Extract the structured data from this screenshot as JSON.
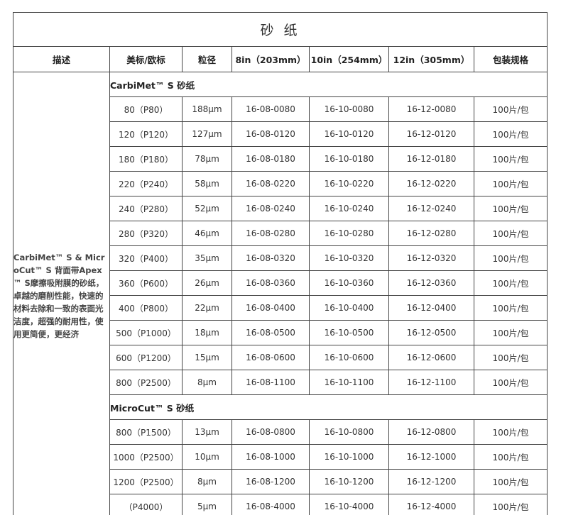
{
  "title": "砂 纸",
  "headers": [
    "描述",
    "美标/欧标",
    "粒径",
    "8in（203mm）",
    "10in（254mm）",
    "12in（305mm）",
    "包装规格"
  ],
  "description": "CarbiMet™ S & MicroCut™ S 背面带Apex™ S摩擦吸附膜的砂纸，卓越的磨削性能，快速的材料去除和一致的表面光洁度，超强的耐用性，使用更简便，更经济",
  "sections": [
    {
      "name": "CarbiMet™ S 砂纸",
      "rows": [
        [
          "80（P80）",
          "188μm",
          "16-08-0080",
          "16-10-0080",
          "16-12-0080",
          "100片/包"
        ],
        [
          "120（P120）",
          "127μm",
          "16-08-0120",
          "16-10-0120",
          "16-12-0120",
          "100片/包"
        ],
        [
          "180（P180）",
          "78μm",
          "16-08-0180",
          "16-10-0180",
          "16-12-0180",
          "100片/包"
        ],
        [
          "220（P240）",
          "58μm",
          "16-08-0220",
          "16-10-0220",
          "16-12-0220",
          "100片/包"
        ],
        [
          "240（P280）",
          "52μm",
          "16-08-0240",
          "16-10-0240",
          "16-12-0240",
          "100片/包"
        ],
        [
          "280（P320）",
          "46μm",
          "16-08-0280",
          "16-10-0280",
          "16-12-0280",
          "100片/包"
        ],
        [
          "320（P400）",
          "35μm",
          "16-08-0320",
          "16-10-0320",
          "16-12-0320",
          "100片/包"
        ],
        [
          "360（P600）",
          "26μm",
          "16-08-0360",
          "16-10-0360",
          "16-12-0360",
          "100片/包"
        ],
        [
          "400（P800）",
          "22μm",
          "16-08-0400",
          "16-10-0400",
          "16-12-0400",
          "100片/包"
        ],
        [
          "500（P1000）",
          "18μm",
          "16-08-0500",
          "16-10-0500",
          "16-12-0500",
          "100片/包"
        ],
        [
          "600（P1200）",
          "15μm",
          "16-08-0600",
          "16-10-0600",
          "16-12-0600",
          "100片/包"
        ],
        [
          "800（P2500）",
          "8μm",
          "16-08-1100",
          "16-10-1100",
          "16-12-1100",
          "100片/包"
        ]
      ]
    },
    {
      "name": "MicroCut™ S 砂纸",
      "rows": [
        [
          "800（P1500）",
          "13μm",
          "16-08-0800",
          "16-10-0800",
          "16-12-0800",
          "100片/包"
        ],
        [
          "1000（P2500）",
          "10μm",
          "16-08-1000",
          "16-10-1000",
          "16-12-1000",
          "100片/包"
        ],
        [
          "1200（P2500）",
          "8μm",
          "16-08-1200",
          "16-10-1200",
          "16-12-1200",
          "100片/包"
        ],
        [
          "（P4000）",
          "5μm",
          "16-08-4000",
          "16-10-4000",
          "16-12-4000",
          "100片/包"
        ]
      ]
    }
  ]
}
